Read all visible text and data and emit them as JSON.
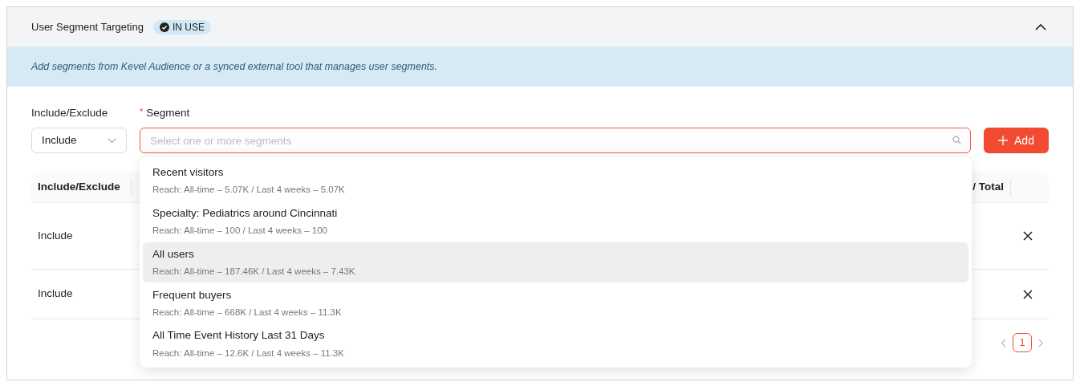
{
  "panel": {
    "title": "User Segment Targeting",
    "badge": "IN USE",
    "expanded": true
  },
  "info": "Add segments from Kevel Audience or a synced external tool that manages user segments.",
  "form": {
    "mode_label": "Include/Exclude",
    "mode_value": "Include",
    "segment_label": "Segment",
    "segment_required": "*",
    "segment_placeholder": "Select one or more segments",
    "add_button": "Add"
  },
  "dropdown": [
    {
      "name": "Recent visitors",
      "reach": "Reach: All-time – 5.07K / Last 4 weeks – 5.07K",
      "selected": false
    },
    {
      "name": "Specialty: Pediatrics around Cincinnati",
      "reach": "Reach: All-time – 100 / Last 4 weeks – 100",
      "selected": false
    },
    {
      "name": "All users",
      "reach": "Reach: All-time – 187.46K / Last 4 weeks – 7.43K",
      "selected": true
    },
    {
      "name": "Frequent buyers",
      "reach": "Reach: All-time – 668K / Last 4 weeks – 11.3K",
      "selected": false
    },
    {
      "name": "All Time Event History Last 31 Days",
      "reach": "Reach: All-time – 12.6K / Last 4 weeks – 11.3K",
      "selected": false
    }
  ],
  "table": {
    "columns": [
      "Include/Exclude",
      "/ Total"
    ],
    "rows": [
      {
        "mode": "Include"
      },
      {
        "mode": "Include"
      }
    ]
  },
  "pagination": {
    "pages": [
      {
        "label": "1",
        "selected": true
      }
    ]
  }
}
